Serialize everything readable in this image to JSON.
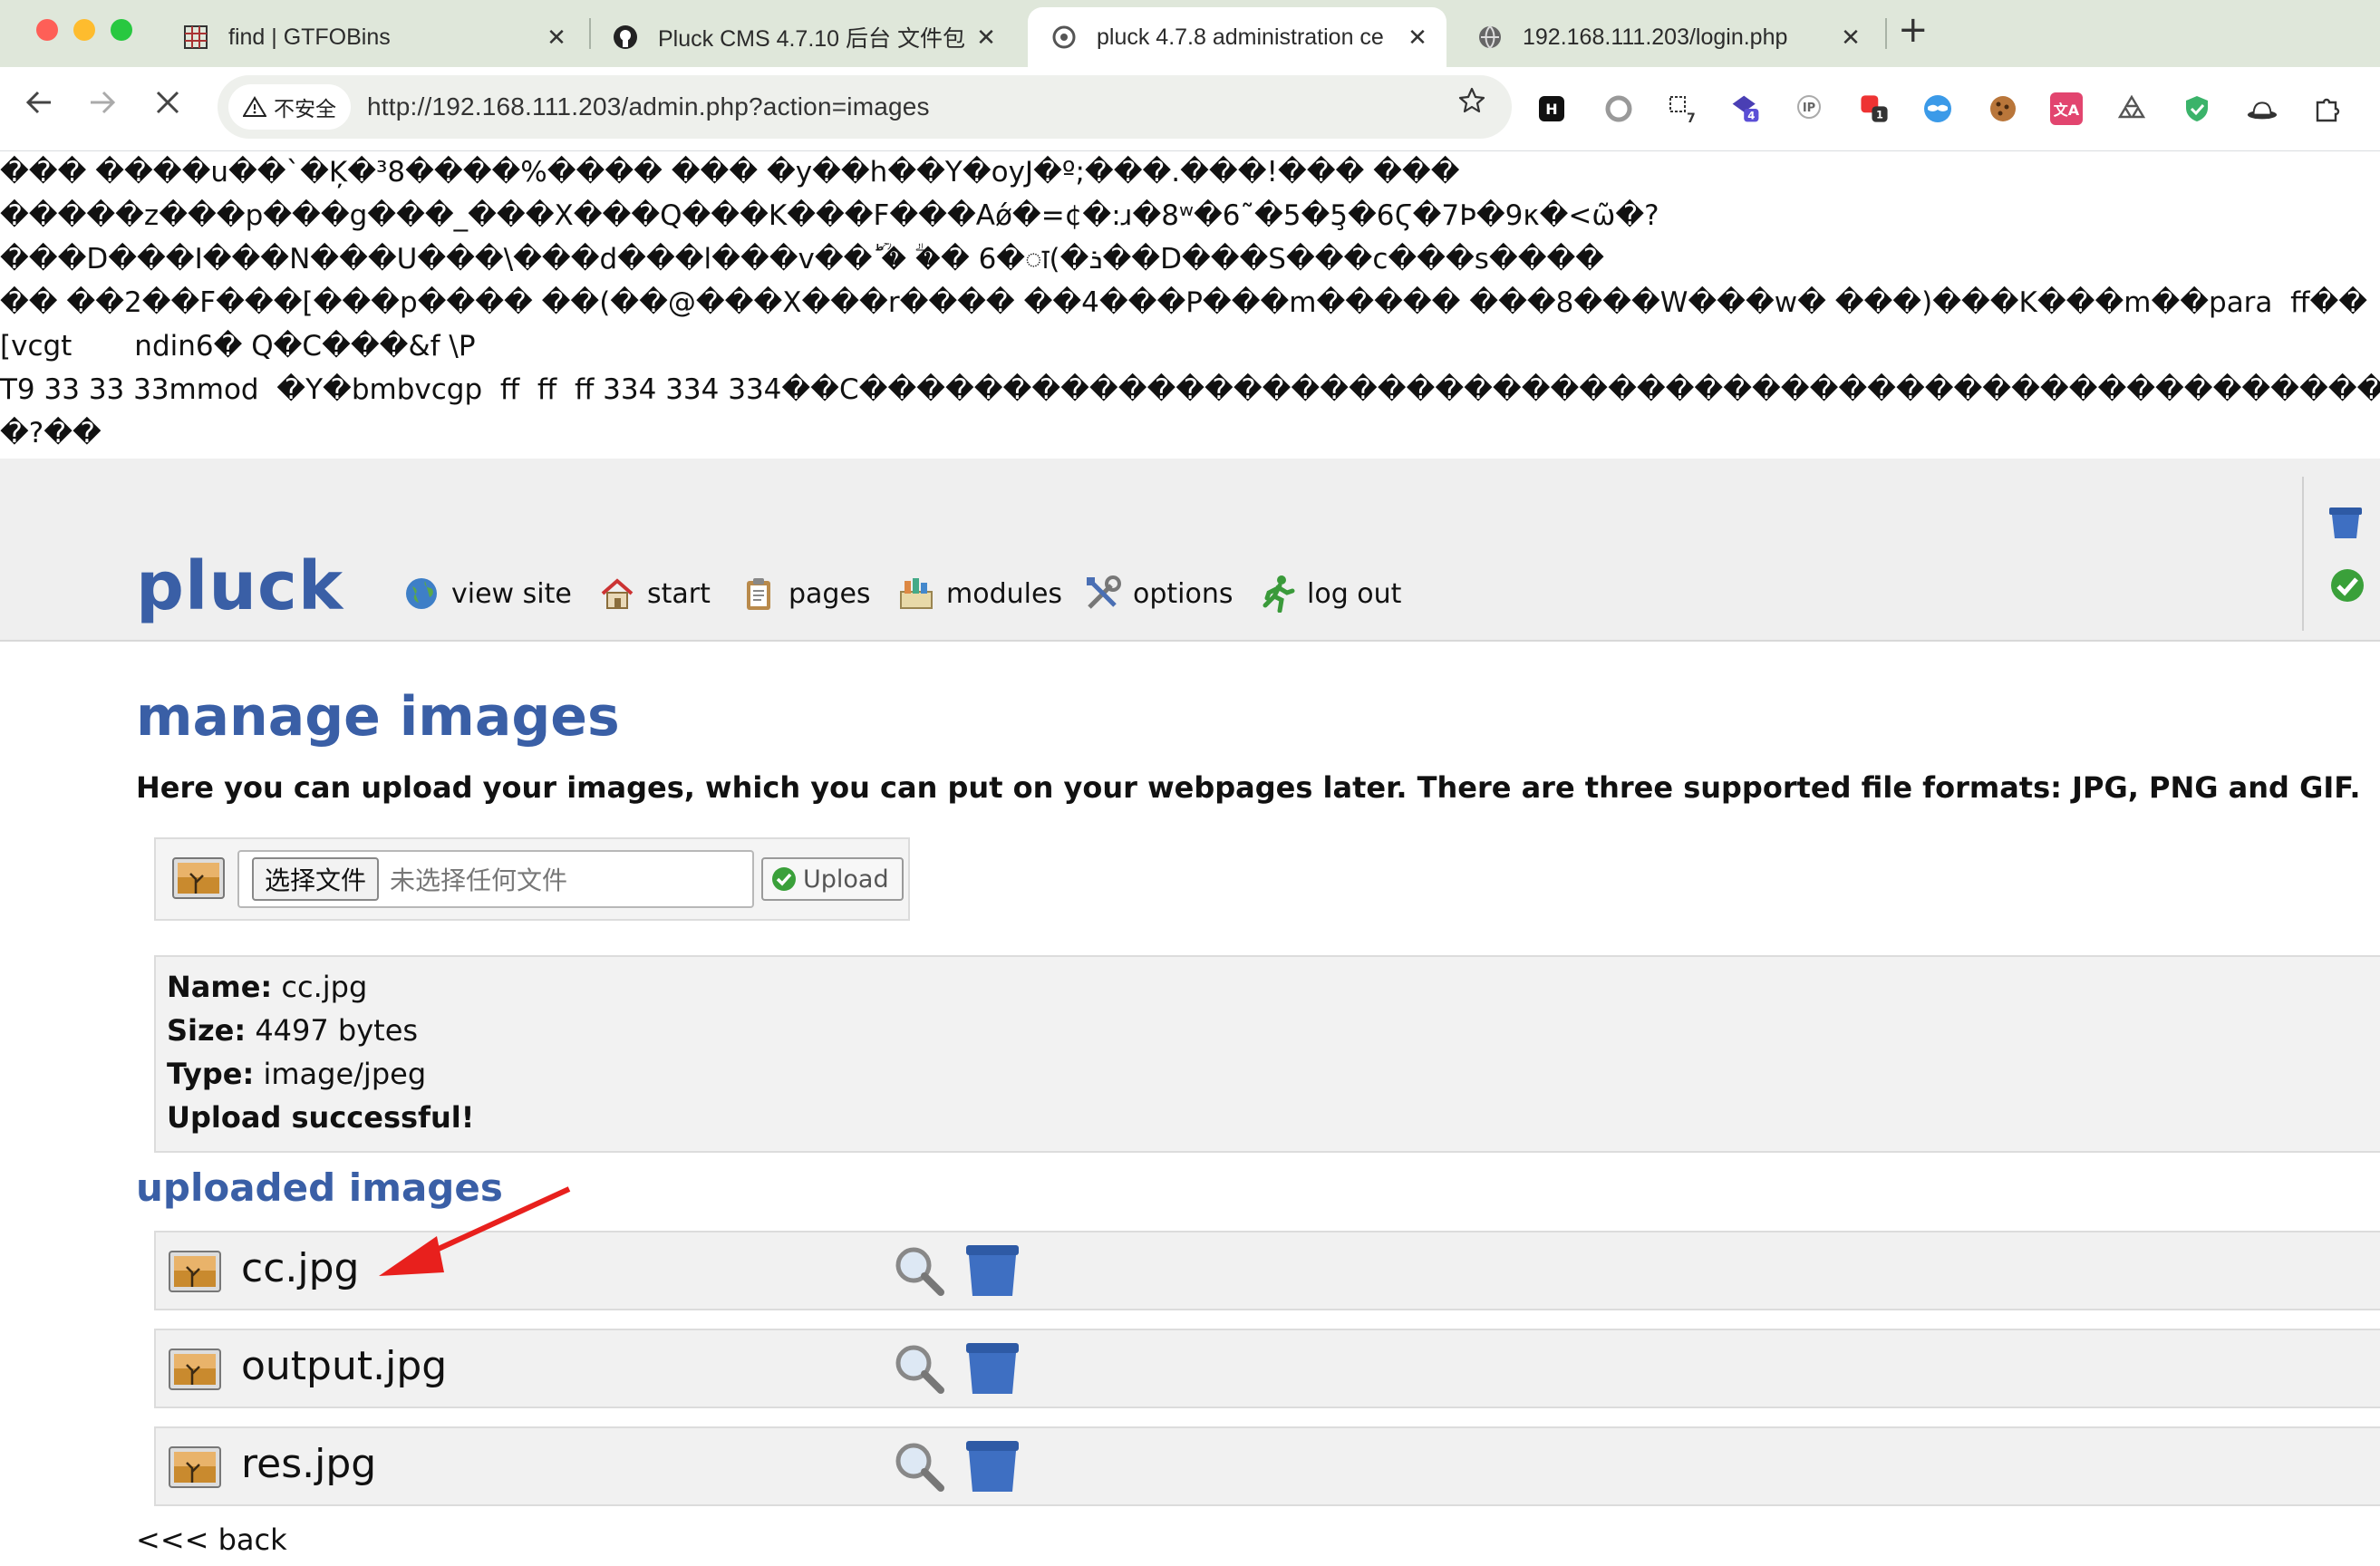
{
  "browser": {
    "tabs": [
      {
        "title": "find | GTFOBins",
        "icon": "grid-favicon"
      },
      {
        "title": "Pluck CMS 4.7.10 后台 文件包",
        "icon": "github-favicon"
      },
      {
        "title": "pluck 4.7.8 administration ce",
        "icon": "pluck-favicon",
        "active": true
      },
      {
        "title": "192.168.111.203/login.php",
        "icon": "globe-favicon"
      }
    ],
    "close_glyph": "✕",
    "new_tab_glyph": "+",
    "security_label": "不安全",
    "url": "http://192.168.111.203/admin.php?action=images",
    "extensions": [
      {
        "name": "h-extension-icon",
        "label": "H"
      },
      {
        "name": "record-extension-icon",
        "label": ""
      },
      {
        "name": "translate-extension-icon",
        "label": "7"
      },
      {
        "name": "cube-extension-icon",
        "label": "4"
      },
      {
        "name": "ip-extension-icon",
        "label": "IP"
      },
      {
        "name": "red-extension-icon",
        "label": "1"
      },
      {
        "name": "mask-extension-icon",
        "label": ""
      },
      {
        "name": "cookie-extension-icon",
        "label": ""
      },
      {
        "name": "translate-pink-extension-icon",
        "label": "文A"
      },
      {
        "name": "recycle-extension-icon",
        "label": ""
      },
      {
        "name": "shield-extension-icon",
        "label": ""
      },
      {
        "name": "hat-extension-icon",
        "label": ""
      },
      {
        "name": "puzzle-extension-icon",
        "label": ""
      }
    ]
  },
  "garbage_lines": [
    "��� ����u��`�Ķ�³8����%���� ��� �y��h��Y�oyJ�º;���.���!��� ���",
    "�����z���p���g���_���X���Q���K���F���Aǿ�=¢�:ɹ�8ʷ�6˜�5�5̧�6Ϛ�7Ϸ�9κ�<ῶ�?",
    "���D���I���N���U���\\���d���l���v��ؕ �ؒ �ؖ� 6�ा(�ܪ��D���S���c���s����",
    "�� ��2��F���[���p���� ��(��@���X���r���� ��4���P���m����� ���8���W���w� ���)���K���m��para  ff��",
    "[vcgt       ndin6� Q�C���&f \\P",
    "T9 33 33 33mmod  �Y�bmbvcgp  ff  ff  ff 334 334 334��C������������������������������������������������������",
    "�?��"
  ],
  "pluck": {
    "logo": "pluck",
    "menu": [
      {
        "label": "view site",
        "icon": "globe-icon"
      },
      {
        "label": "start",
        "icon": "home-icon"
      },
      {
        "label": "pages",
        "icon": "clipboard-icon"
      },
      {
        "label": "modules",
        "icon": "modules-icon"
      },
      {
        "label": "options",
        "icon": "tools-icon"
      },
      {
        "label": "log out",
        "icon": "running-man-icon"
      }
    ]
  },
  "main": {
    "title": "manage images",
    "intro": "Here you can upload your images, which you can put on your webpages later. There are three supported file formats: JPG, PNG and GIF.",
    "upload": {
      "choose_label": "选择文件",
      "no_file_label": "未选择任何文件",
      "upload_label": "Upload"
    },
    "result": {
      "name_label": "Name:",
      "name_value": "cc.jpg",
      "size_label": "Size:",
      "size_value": "4497 bytes",
      "type_label": "Type:",
      "type_value": "image/jpeg",
      "status": "Upload successful!"
    },
    "uploaded_title": "uploaded images",
    "images": [
      {
        "name": "cc.jpg"
      },
      {
        "name": "output.jpg"
      },
      {
        "name": "res.jpg"
      }
    ],
    "back_label": "<<< back"
  },
  "colors": {
    "accent": "#3a5fa6",
    "annotation_arrow": "#e8201d",
    "tabbar": "#dfe7da"
  }
}
